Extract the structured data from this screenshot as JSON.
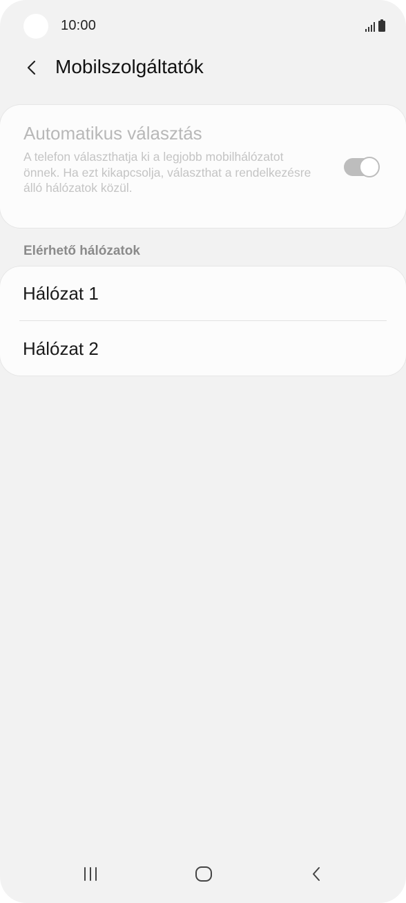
{
  "status_bar": {
    "time": "10:00",
    "icons": [
      "signal-icon",
      "battery-icon"
    ]
  },
  "header": {
    "back_icon": "chevron-left-icon",
    "title": "Mobilszolgáltatók"
  },
  "auto_select": {
    "title": "Automatikus választás",
    "description": "A telefon választhatja ki a legjobb mobilhálózatot önnek. Ha ezt kikapcsolja, választhat a rendelkezésre álló hálózatok közül.",
    "toggle_state": "on",
    "enabled": false
  },
  "networks": {
    "section_title": "Elérhető hálózatok",
    "items": [
      {
        "label": "Hálózat 1"
      },
      {
        "label": "Hálózat 2"
      }
    ]
  },
  "nav_bar": {
    "recents_icon": "recents-icon",
    "home_icon": "home-icon",
    "back_icon": "back-icon"
  },
  "colors": {
    "background": "#f2f2f2",
    "card": "#fcfcfc",
    "disabled_text": "#b8b8b8",
    "primary_text": "#1a1a1a",
    "section_text": "#8a8a8a"
  }
}
